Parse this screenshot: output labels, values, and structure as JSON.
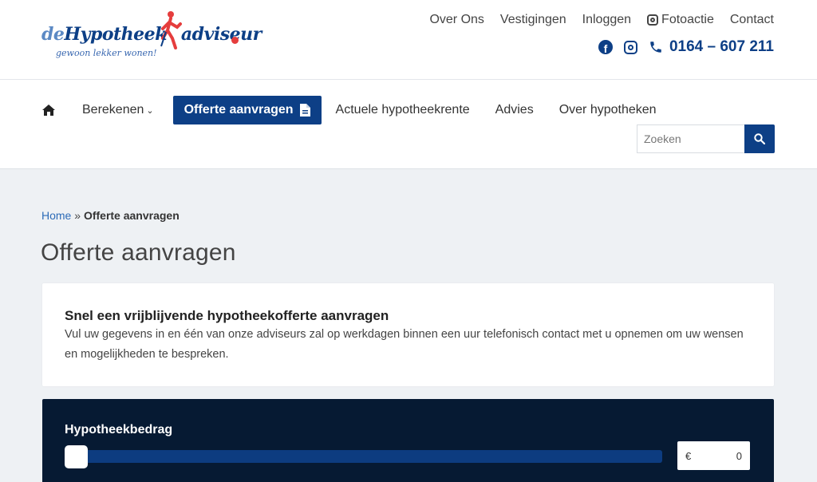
{
  "brand": {
    "logo_prefix": "de",
    "logo_main": "Hypotheek",
    "logo_suffix": "adviseur",
    "tagline": "gewoon lekker wonen!"
  },
  "top_links": [
    "Over Ons",
    "Vestigingen",
    "Inloggen",
    "Fotoactie",
    "Contact"
  ],
  "social": {
    "icons": [
      "facebook-icon",
      "instagram-icon"
    ],
    "phone": "0164 – 607 211"
  },
  "nav": {
    "items": [
      "Berekenen",
      "Offerte aanvragen",
      "Actuele hypotheekrente",
      "Advies",
      "Over hypotheken"
    ],
    "search_placeholder": "Zoeken"
  },
  "breadcrumb": {
    "home": "Home",
    "separator": "»",
    "current": "Offerte aanvragen"
  },
  "page_title": "Offerte aanvragen",
  "intro": {
    "heading": "Snel een vrijblijvende hypotheekofferte aanvragen",
    "text": "Vul uw gegevens in en één van onze adviseurs zal op werkdagen binnen een uur telefonisch contact met u opnemen om uw wensen en mogelijkheden te bespreken."
  },
  "form": {
    "amount_label": "Hypotheekbedrag",
    "currency": "€",
    "amount_value": "0",
    "slider_fraction": 0
  },
  "colors": {
    "brand": "#0d3f86",
    "accent": "#e53d3d",
    "panel": "#061a33",
    "background": "#eef1f4"
  }
}
